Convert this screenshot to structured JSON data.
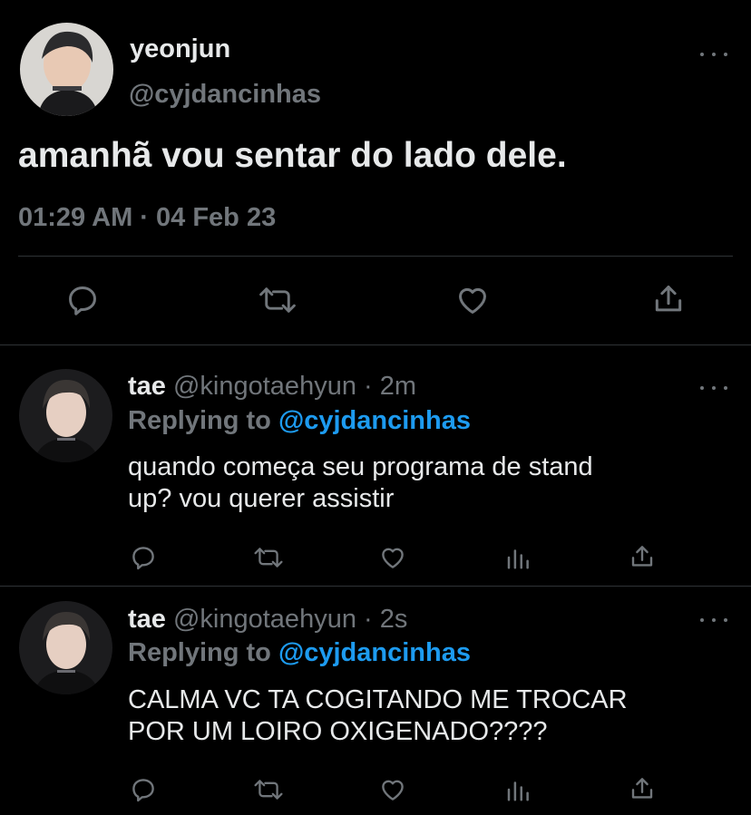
{
  "main_tweet": {
    "name": "yeonjun",
    "handle": "@cyjdancinhas",
    "text": "amanhã vou sentar do lado dele.",
    "timestamp": "01:29 AM · 04 Feb 23",
    "actions": [
      "reply-icon",
      "retweet-icon",
      "like-icon",
      "share-icon"
    ]
  },
  "replies": [
    {
      "name": "tae",
      "handle": "@kingotaehyun",
      "time": "· 2m",
      "replying_prefix": "Replying to",
      "replying_handle": "@cyjdancinhas",
      "text_lines": [
        "quando começa seu programa de stand",
        "up? vou querer assistir"
      ]
    },
    {
      "name": "tae",
      "handle": "@kingotaehyun",
      "time": "· 2s",
      "replying_prefix": "Replying to",
      "replying_handle": "@cyjdancinhas",
      "text_lines": [
        "CALMA VC TA COGITANDO ME TROCAR",
        "POR UM LOIRO OXIGENADO????"
      ]
    }
  ],
  "colors": {
    "background": "#000000",
    "text": "#e7e9ea",
    "muted": "#71767b",
    "link": "#1d9bf0",
    "divider": "#2f3336"
  }
}
